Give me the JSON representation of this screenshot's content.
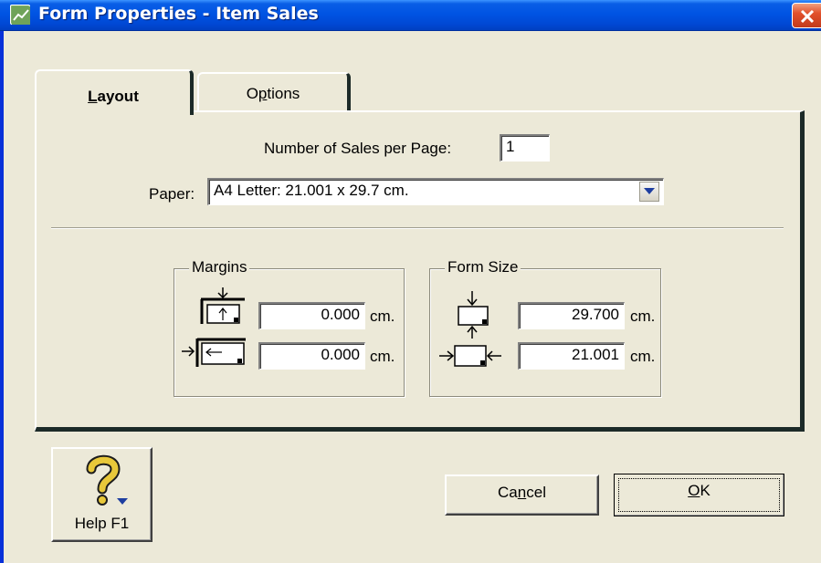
{
  "window": {
    "title": "Form Properties - Item Sales"
  },
  "tabs": {
    "layout": {
      "label_u": "L",
      "label_rest": "ayout",
      "selected": true
    },
    "options": {
      "label_pre": "O",
      "label_u": "p",
      "label_rest": "tions",
      "selected": false
    }
  },
  "layout": {
    "sales_per_page_label": "Number of Sales per Page:",
    "sales_per_page_value": "1",
    "paper_label": "Paper:",
    "paper_value": "A4 Letter:  21.001 x 29.7 cm.",
    "margins": {
      "title": "Margins",
      "top_value": "0.000",
      "left_value": "0.000",
      "unit": "cm."
    },
    "form_size": {
      "title": "Form Size",
      "height_value": "29.700",
      "width_value": "21.001",
      "unit": "cm."
    }
  },
  "buttons": {
    "help_label": "Help F1",
    "cancel_pre": "Ca",
    "cancel_u": "n",
    "cancel_rest": "cel",
    "ok_u": "O",
    "ok_rest": "K"
  },
  "colors": {
    "titlebar": "#0054e3",
    "dialog_bg": "#ece9d8",
    "close_button": "#e2512c"
  }
}
